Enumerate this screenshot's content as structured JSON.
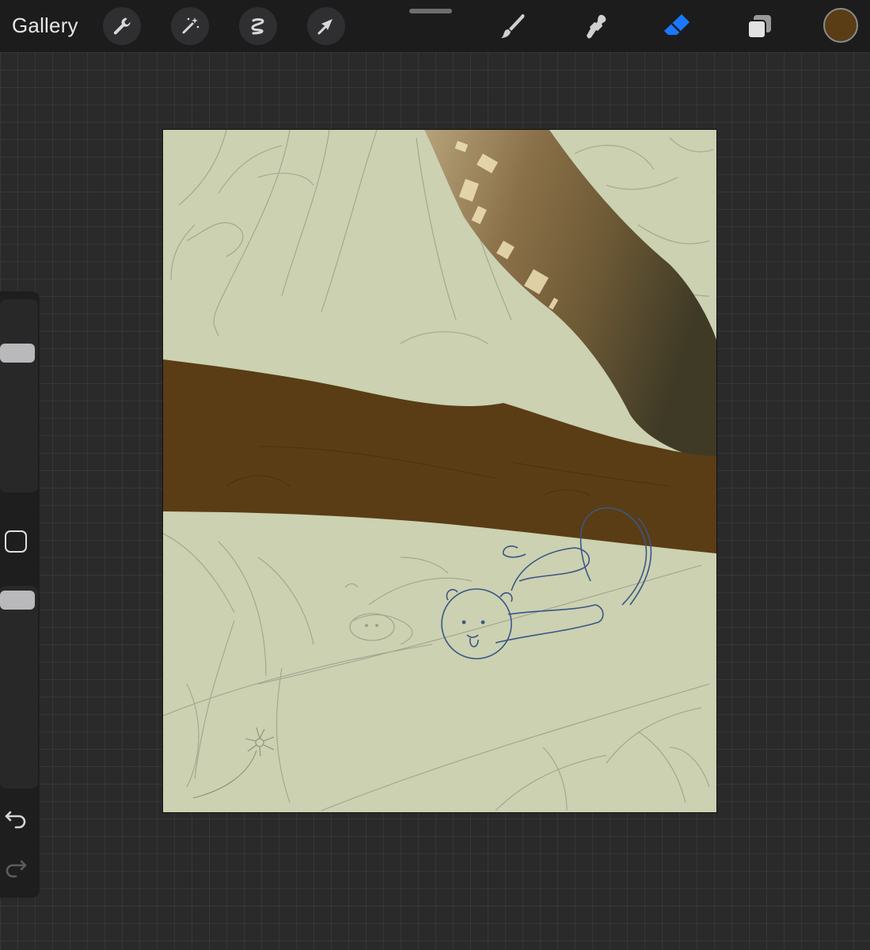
{
  "toolbar": {
    "gallery_label": "Gallery",
    "left_tools": [
      "wrench-icon",
      "magic-wand-icon",
      "selection-icon",
      "transform-arrow-icon"
    ],
    "right_tools": [
      "brush-icon",
      "smudge-icon",
      "eraser-icon",
      "layers-icon"
    ],
    "active_tool": "eraser",
    "accent_color": "#1a78ff",
    "current_color": "#5a3d14"
  },
  "sidebar": {
    "brush_size_slider": "slider",
    "opacity_slider": "slider",
    "modify_button": "square-icon",
    "undo": "undo-icon",
    "redo": "redo-icon"
  },
  "canvas": {
    "background_color": "#cbd1b1",
    "branch_color": "#5a3d14"
  }
}
